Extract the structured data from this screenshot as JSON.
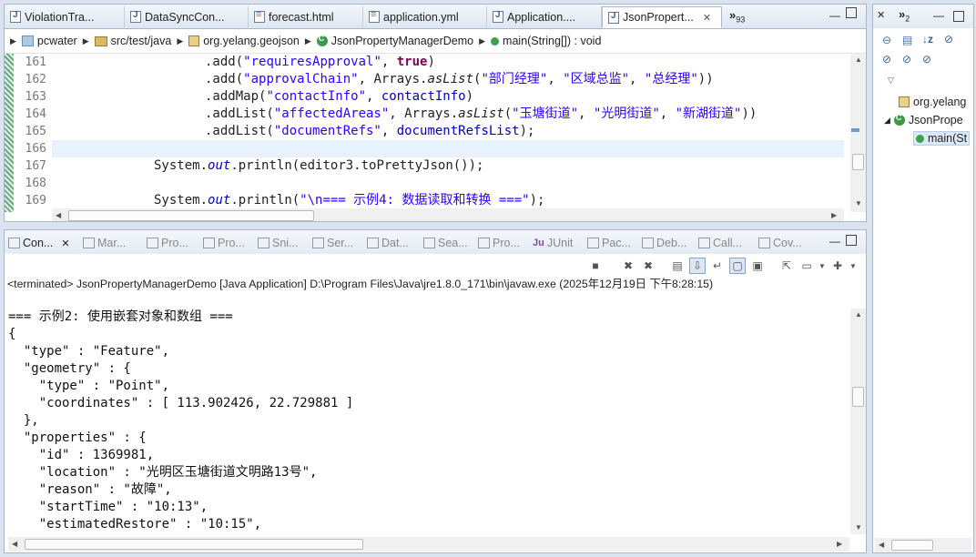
{
  "editor": {
    "tabs": [
      {
        "label": "ViolationTra...",
        "icon": "java-file-icon"
      },
      {
        "label": "DataSyncCon...",
        "icon": "java-file-icon"
      },
      {
        "label": "forecast.html",
        "icon": "html-file-icon"
      },
      {
        "label": "application.yml",
        "icon": "yml-file-icon"
      },
      {
        "label": "Application....",
        "icon": "java-file-icon"
      },
      {
        "label": "JsonPropert...",
        "icon": "java-file-icon",
        "active": true
      }
    ],
    "overflow_label": "»",
    "overflow_count": "93",
    "breadcrumb": [
      "pcwater",
      "src/test/java",
      "org.yelang.geojson",
      "JsonPropertyManagerDemo",
      "main(String[]) : void"
    ],
    "lines": [
      {
        "num": "161",
        "text": ".add(\"requiresApproval\", true)"
      },
      {
        "num": "162",
        "text": ".add(\"approvalChain\", Arrays.asList(\"部门经理\", \"区域总监\", \"总经理\"))"
      },
      {
        "num": "163",
        "text": ".addMap(\"contactInfo\", contactInfo)"
      },
      {
        "num": "164",
        "text": ".addList(\"affectedAreas\", Arrays.asList(\"玉塘街道\", \"光明街道\", \"新湖街道\"))"
      },
      {
        "num": "165",
        "text": ".addList(\"documentRefs\", documentRefsList);"
      },
      {
        "num": "166",
        "text": ""
      },
      {
        "num": "167",
        "text": "System.out.println(editor3.toPrettyJson());"
      },
      {
        "num": "168",
        "text": ""
      },
      {
        "num": "169",
        "text": "System.out.println(\"\\n=== 示例4: 数据读取和转换 ===\");"
      }
    ]
  },
  "console": {
    "tabs": [
      "Con...",
      "Mar...",
      "Pro...",
      "Pro...",
      "Sni...",
      "Ser...",
      "Dat...",
      "Sea...",
      "Pro...",
      "JUnit",
      "Pac...",
      "Deb...",
      "Call...",
      "Cov..."
    ],
    "terminated": "<terminated> JsonPropertyManagerDemo [Java Application] D:\\Program Files\\Java\\jre1.8.0_171\\bin\\javaw.exe (2025年12月19日 下午8:28:15)",
    "output": [
      "=== 示例2: 使用嵌套对象和数组 ===",
      "{",
      "  \"type\" : \"Feature\",",
      "  \"geometry\" : {",
      "    \"type\" : \"Point\",",
      "    \"coordinates\" : [ 113.902426, 22.729881 ]",
      "  },",
      "  \"properties\" : {",
      "    \"id\" : 1369981,",
      "    \"location\" : \"光明区玉塘街道文明路13号\",",
      "    \"reason\" : \"故障\",",
      "    \"startTime\" : \"10:13\",",
      "    \"estimatedRestore\" : \"10:15\","
    ]
  },
  "outline": {
    "tab_count": "2",
    "items": [
      "org.yelang",
      "JsonPrope",
      "main(St"
    ]
  }
}
